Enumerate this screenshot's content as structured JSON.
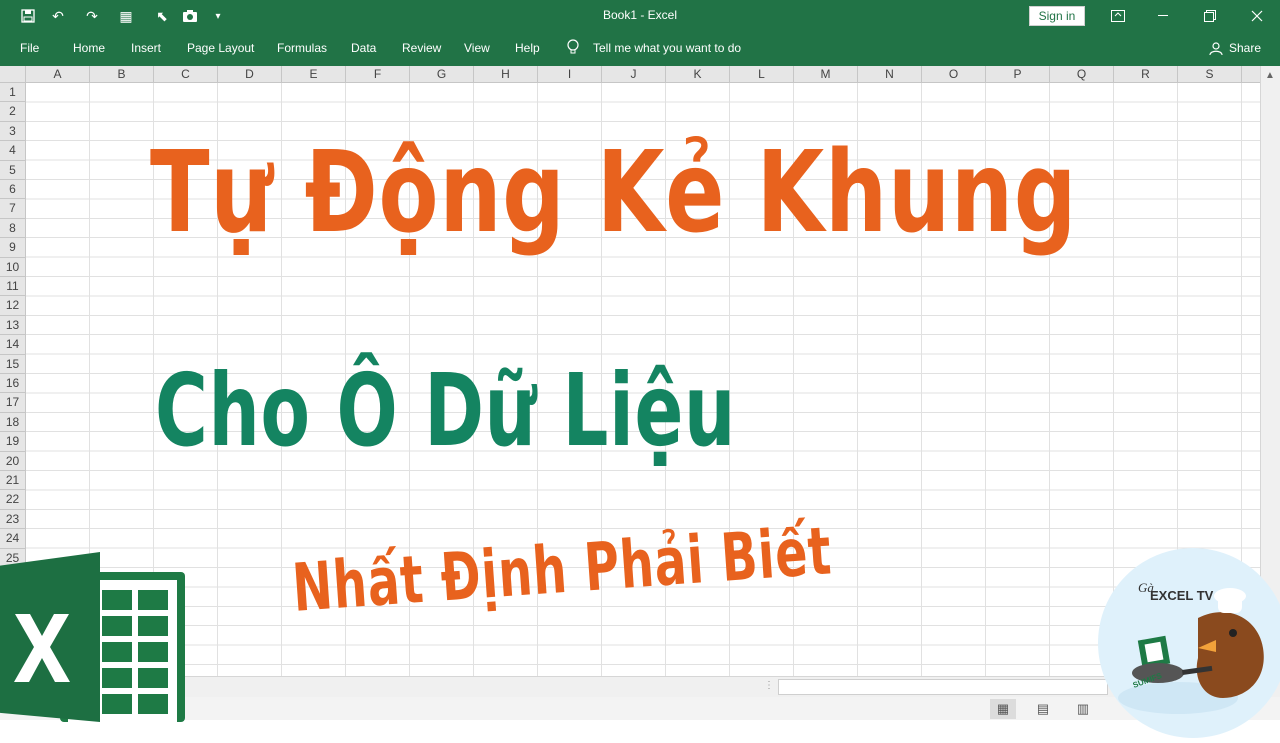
{
  "titlebar": {
    "title": "Book1 - Excel",
    "signin": "Sign in",
    "bg_color": "#217346"
  },
  "qat": {
    "icons": [
      "save-icon",
      "undo-icon",
      "redo-icon",
      "form-icon",
      "select-icon",
      "camera-icon",
      "customize-icon"
    ]
  },
  "ribbon": {
    "tabs": [
      "File",
      "Home",
      "Insert",
      "Page Layout",
      "Formulas",
      "Data",
      "Review",
      "View",
      "Help"
    ],
    "tell_me": "Tell me what you want to do",
    "share": "Share"
  },
  "sheet": {
    "columns": [
      "A",
      "B",
      "C",
      "D",
      "E",
      "F",
      "G",
      "H",
      "I",
      "J",
      "K",
      "L",
      "M",
      "N",
      "O",
      "P",
      "Q",
      "R",
      "S"
    ],
    "rows": [
      "1",
      "2",
      "3",
      "4",
      "5",
      "6",
      "7",
      "8",
      "9",
      "10",
      "11",
      "12",
      "13",
      "14",
      "15",
      "16",
      "17",
      "18",
      "19",
      "20",
      "21",
      "22",
      "23",
      "24",
      "25"
    ]
  },
  "overlay": {
    "line1": "Tự Động Kẻ Khung",
    "line2": "Cho Ô Dữ Liệu",
    "line3": "Nhất Định Phải Biết",
    "line1_color": "#e8621e",
    "line2_color": "#148461",
    "line3_color": "#e8621e"
  },
  "badge": {
    "brand": "Gà EXCEL TV",
    "brand_prefix": "Gà",
    "brand_main": "EXCEL TV"
  }
}
